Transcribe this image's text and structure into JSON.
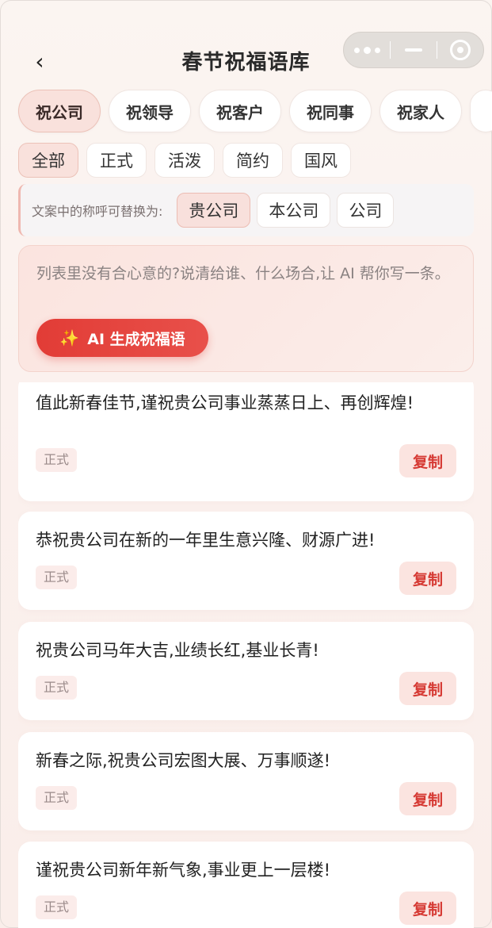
{
  "header": {
    "back": "‹",
    "title": "春节祝福语库"
  },
  "categories": [
    "祝公司",
    "祝领导",
    "祝客户",
    "祝同事",
    "祝家人"
  ],
  "styles": [
    "全部",
    "正式",
    "活泼",
    "简约",
    "国风"
  ],
  "replace": {
    "label": "文案中的称呼可替换为:",
    "options": [
      "贵公司",
      "本公司",
      "公司"
    ]
  },
  "ai": {
    "prompt": "列表里没有合心意的?说清给谁、什么场合,让 AI 帮你写一条。",
    "button": "AI 生成祝福语"
  },
  "messages": [
    {
      "text": "值此新春佳节,谨祝贵公司事业蒸蒸日上、再创辉煌!",
      "tag": "正式",
      "copy": "复制"
    },
    {
      "text": "恭祝贵公司在新的一年里生意兴隆、财源广进!",
      "tag": "正式",
      "copy": "复制"
    },
    {
      "text": "祝贵公司马年大吉,业绩长红,基业长青!",
      "tag": "正式",
      "copy": "复制"
    },
    {
      "text": "新春之际,祝贵公司宏图大展、万事顺遂!",
      "tag": "正式",
      "copy": "复制"
    },
    {
      "text": "谨祝贵公司新年新气象,事业更上一层楼!",
      "tag": "正式",
      "copy": "复制"
    }
  ]
}
